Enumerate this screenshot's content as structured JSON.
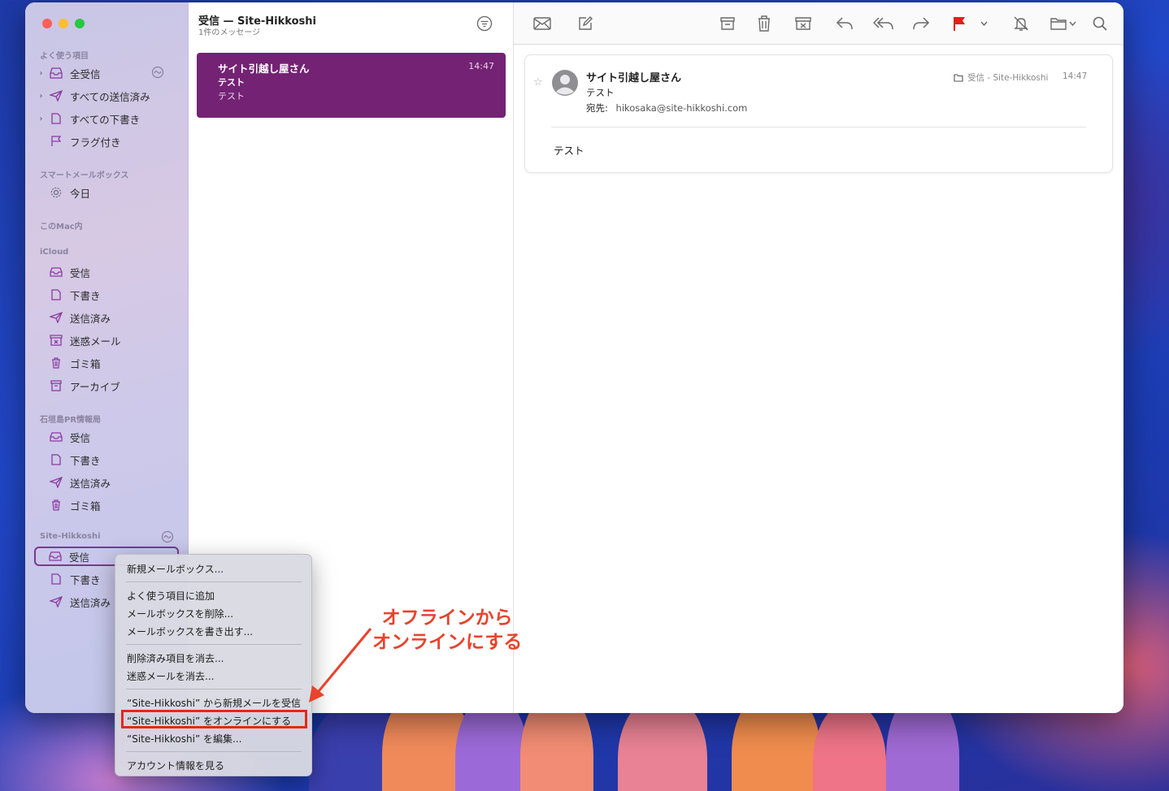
{
  "sidebar": {
    "sections": {
      "favorites": "よく使う項目",
      "smart": "スマートメールボックス",
      "mac": "このMac内",
      "icloud": "iCloud",
      "ishigaki": "石垣島PR情報局",
      "site": "Site-Hikkoshi"
    },
    "favorites": [
      "全受信",
      "すべての送信済み",
      "すべての下書き",
      "フラグ付き"
    ],
    "smart_items": [
      "今日"
    ],
    "icloud": [
      "受信",
      "下書き",
      "送信済み",
      "迷惑メール",
      "ゴミ箱",
      "アーカイブ"
    ],
    "ishigaki": [
      "受信",
      "下書き",
      "送信済み",
      "ゴミ箱"
    ],
    "site": [
      "受信",
      "下書き",
      "送信済み"
    ]
  },
  "list": {
    "title": "受信 — Site-Hikkoshi",
    "subtitle": "1件のメッセージ",
    "messages": [
      {
        "sender": "サイト引越し屋さん",
        "time": "14:47",
        "subject": "テスト",
        "preview": "テスト"
      }
    ]
  },
  "reader": {
    "sender": "サイト引越し屋さん",
    "subject": "テスト",
    "to_label": "宛先:",
    "to_address": "hikosaka@site-hikkoshi.com",
    "mailbox": "受信 - Site-Hikkoshi",
    "time": "14:47",
    "body": "テスト"
  },
  "context_menu": {
    "items": [
      "新規メールボックス...",
      "よく使う項目に追加",
      "メールボックスを削除...",
      "メールボックスを書き出す...",
      "削除済み項目を消去...",
      "迷惑メールを消去...",
      "“Site-Hikkoshi” から新規メールを受信",
      "“Site-Hikkoshi” をオンラインにする",
      "“Site-Hikkoshi” を編集...",
      "アカウント情報を見る"
    ]
  },
  "annotation": {
    "line1": "オフラインから",
    "line2": "オンラインにする"
  },
  "colors": {
    "accent": "#742274",
    "flag": "#e0201a",
    "annotation": "#e8432c",
    "sidebar_icon": "#8a3aa0"
  }
}
